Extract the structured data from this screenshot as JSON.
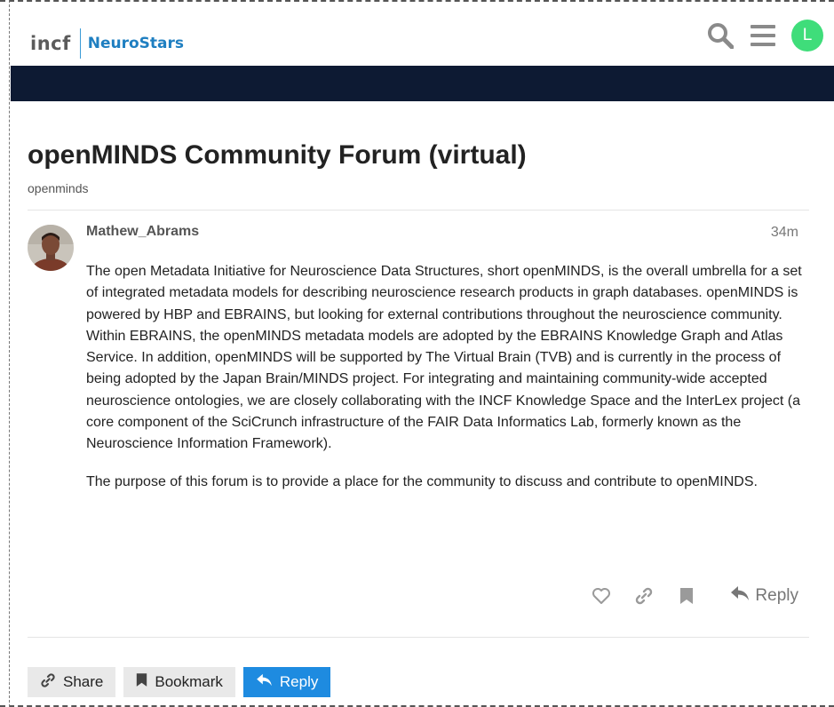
{
  "header": {
    "logo_incf": "incf",
    "logo_site": "NeuroStars",
    "user_initial": "L",
    "icons": [
      "search-icon",
      "hamburger-menu-icon"
    ]
  },
  "topic": {
    "title": "openMINDS Community Forum (virtual)",
    "category": "openminds"
  },
  "post": {
    "author": "Mathew_Abrams",
    "age": "34m",
    "paragraphs": [
      "The open Metadata Initiative for Neuroscience Data Structures, short openMINDS, is the overall umbrella for a set of integrated metadata models for describing neuroscience research products in graph databases. openMINDS is powered by HBP and EBRAINS, but looking for external contributions throughout the neuroscience community. Within EBRAINS, the openMINDS metadata models are adopted by the EBRAINS Knowledge Graph and Atlas Service. In addition, openMINDS will be supported by The Virtual Brain (TVB) and is currently in the process of being adopted by the Japan Brain/MINDS project. For integrating and maintaining community-wide accepted neuroscience ontologies, we are closely collaborating with the INCF Knowledge Space and the InterLex project (a core component of the SciCrunch infrastructure of the FAIR Data Informatics Lab, formerly known as the Neuroscience Information Framework).",
      "The purpose of this forum is to provide a place for the community to discuss and contribute to openMINDS."
    ],
    "actions": {
      "icons": [
        "heart-icon",
        "link-icon",
        "bookmark-icon"
      ],
      "reply_label": "Reply"
    }
  },
  "footer_buttons": {
    "share_label": "Share",
    "bookmark_label": "Bookmark",
    "reply_label": "Reply"
  },
  "colors": {
    "navy_bar": "#0d1a33",
    "brand_blue": "#1f7fc1",
    "primary_button": "#1e8be0",
    "user_avatar": "#3fdd7a"
  }
}
